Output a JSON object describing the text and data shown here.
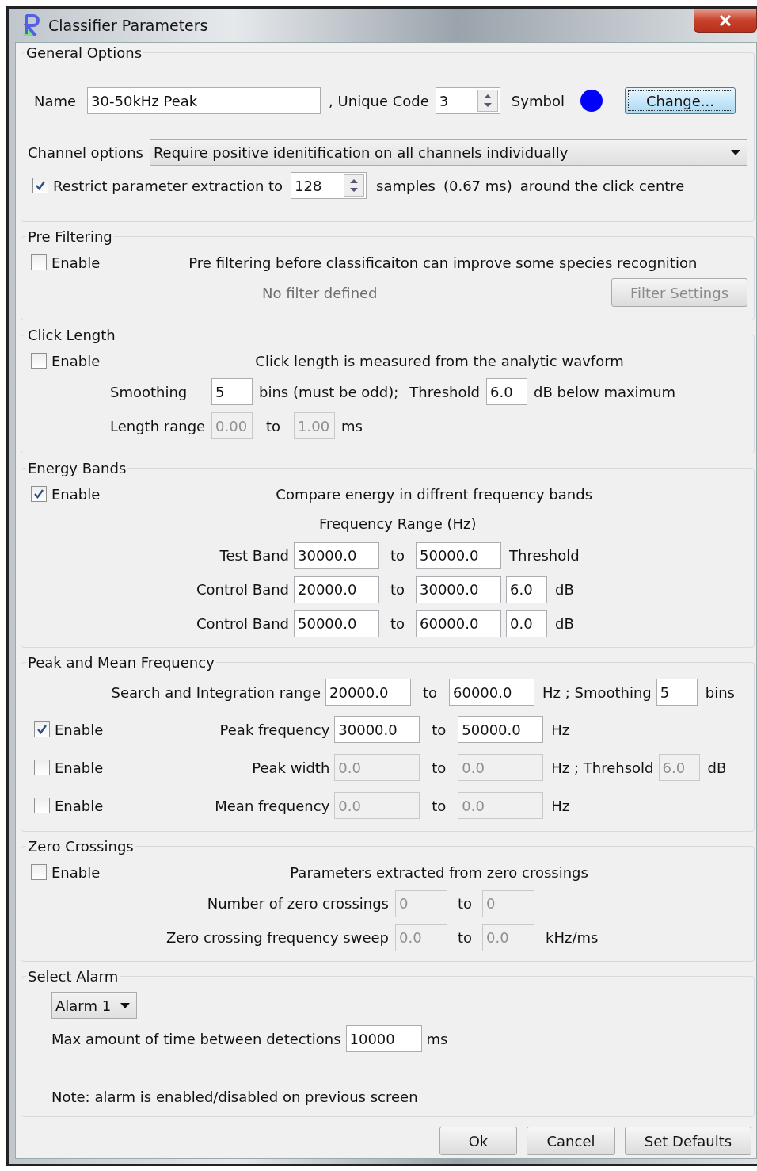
{
  "window": {
    "title": "Classifier Parameters"
  },
  "general": {
    "title": "General Options",
    "name_label": "Name",
    "name": "30-50kHz Peak",
    "code_label": ", Unique Code",
    "code": "3",
    "symbol_label": "Symbol",
    "change_button": "Change...",
    "channel_label": "Channel options",
    "channel_value": "Require positive idenitification on all channels individually",
    "restrict": {
      "checked": true,
      "label": "Restrict parameter extraction to"
    },
    "samples": "128",
    "samples_text": "samples",
    "ms_text": "(0.67 ms)",
    "around_text": "around the click centre"
  },
  "pre_filtering": {
    "title": "Pre Filtering",
    "enable": {
      "checked": false,
      "label": "Enable"
    },
    "description": "Pre filtering before classificaiton can improve some species recognition",
    "status": "No filter defined",
    "button": {
      "label": "Filter Settings",
      "disabled": true
    }
  },
  "click_length": {
    "title": "Click Length",
    "enable": {
      "checked": false,
      "label": "Enable"
    },
    "description": "Click length is measured from the analytic wavform",
    "smoothing_label": "Smoothing",
    "smoothing": {
      "value": "5",
      "disabled": false
    },
    "bins_text": "bins (must be odd);",
    "threshold_label": "Threshold",
    "threshold": {
      "value": "6.0",
      "disabled": false
    },
    "threshold_unit": "dB below maximum",
    "range_label": "Length range",
    "range_from": {
      "value": "0.00",
      "disabled": true
    },
    "range_to_text": "to",
    "range_to": {
      "value": "1.00",
      "disabled": true
    },
    "range_unit": "ms"
  },
  "energy_bands": {
    "title": "Energy Bands",
    "enable": {
      "checked": true,
      "label": "Enable"
    },
    "description": "Compare energy in diffrent frequency bands",
    "range_title": "Frequency Range (Hz)",
    "bands": [
      {
        "kind": "test",
        "label": "Test Band",
        "from": {
          "value": "30000.0",
          "disabled": false
        },
        "to_text": "to",
        "to": {
          "value": "50000.0",
          "disabled": false
        },
        "threshold_label": "Threshold"
      },
      {
        "kind": "control",
        "label": "Control Band",
        "from": {
          "value": "20000.0",
          "disabled": false
        },
        "to_text": "to",
        "to": {
          "value": "30000.0",
          "disabled": false
        },
        "threshold": {
          "value": "6.0",
          "disabled": false
        },
        "unit": "dB"
      },
      {
        "kind": "control",
        "label": "Control Band",
        "from": {
          "value": "50000.0",
          "disabled": false
        },
        "to_text": "to",
        "to": {
          "value": "60000.0",
          "disabled": false
        },
        "threshold": {
          "value": "0.0",
          "disabled": false
        },
        "unit": "dB"
      }
    ]
  },
  "peak_mean": {
    "title": "Peak and Mean Frequency",
    "search": {
      "label": "Search and Integration range",
      "from": {
        "value": "20000.0",
        "disabled": false
      },
      "to_text": "to",
      "to": {
        "value": "60000.0",
        "disabled": false
      },
      "unit": "Hz ; Smoothing",
      "smoothing": {
        "value": "5",
        "disabled": false
      },
      "bins": "bins"
    },
    "rows": [
      {
        "enable": {
          "checked": true,
          "label": "Enable"
        },
        "label": "Peak frequency",
        "from": {
          "value": "30000.0",
          "disabled": false
        },
        "to_text": "to",
        "to": {
          "value": "50000.0",
          "disabled": false
        },
        "unit": "Hz"
      },
      {
        "enable": {
          "checked": false,
          "label": "Enable"
        },
        "label": "Peak width",
        "from": {
          "value": "0.0",
          "disabled": true
        },
        "to_text": "to",
        "to": {
          "value": "0.0",
          "disabled": true
        },
        "unit": "Hz ; Threhsold",
        "extra": {
          "value": "6.0",
          "disabled": true
        },
        "extra_unit": "dB"
      },
      {
        "enable": {
          "checked": false,
          "label": "Enable"
        },
        "label": "Mean frequency",
        "from": {
          "value": "0.0",
          "disabled": true
        },
        "to_text": "to",
        "to": {
          "value": "0.0",
          "disabled": true
        },
        "unit": "Hz"
      }
    ]
  },
  "zero_crossings": {
    "title": "Zero Crossings",
    "enable": {
      "checked": false,
      "label": "Enable"
    },
    "description": "Parameters extracted from zero crossings",
    "rows": [
      {
        "label": "Number of zero crossings",
        "from": {
          "value": "0",
          "disabled": true
        },
        "to_text": "to",
        "to": {
          "value": "0",
          "disabled": true
        }
      },
      {
        "label": "Zero crossing frequency sweep",
        "from": {
          "value": "0.0",
          "disabled": true
        },
        "to_text": "to",
        "to": {
          "value": "0.0",
          "disabled": true
        },
        "unit": "kHz/ms"
      }
    ]
  },
  "alarm": {
    "title": "Select Alarm",
    "dropdown": "Alarm 1",
    "max_label": "Max amount of time between detections",
    "max_value": "10000",
    "unit": "ms",
    "note": "Note: alarm is enabled/disabled on previous screen"
  },
  "buttons": [
    "Ok",
    "Cancel",
    "Set Defaults"
  ]
}
